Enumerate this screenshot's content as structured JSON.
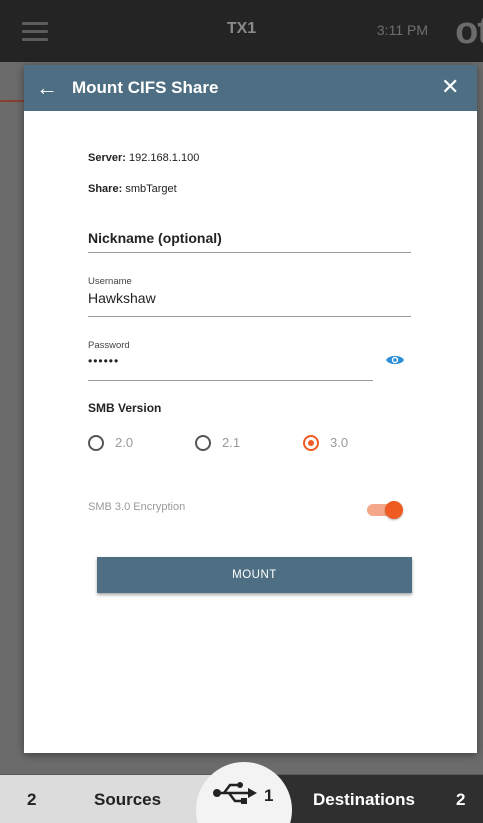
{
  "topbar": {
    "device_name": "TX1",
    "time": "3:11 PM",
    "logo_text": "ot"
  },
  "modal": {
    "title": "Mount CIFS Share",
    "server_label": "Server:",
    "server_value": "192.168.1.100",
    "share_label": "Share:",
    "share_value": "smbTarget",
    "nickname_placeholder": "Nickname (optional)",
    "username_label": "Username",
    "username_value": "Hawkshaw",
    "password_label": "Password",
    "password_value": "••••••",
    "smb_version_title": "SMB Version",
    "smb_versions": [
      {
        "label": "2.0",
        "selected": false
      },
      {
        "label": "2.1",
        "selected": false
      },
      {
        "label": "3.0",
        "selected": true
      }
    ],
    "encryption_label": "SMB 3.0 Encryption",
    "encryption_enabled": true,
    "mount_label": "MOUNT"
  },
  "bottom_nav": {
    "sources_count": "2",
    "sources_label": "Sources",
    "usb_count": "1",
    "destinations_label": "Destinations",
    "destinations_count": "2"
  },
  "colors": {
    "accent": "#f05a23",
    "header": "#4e6f83",
    "topbar": "#242424"
  }
}
